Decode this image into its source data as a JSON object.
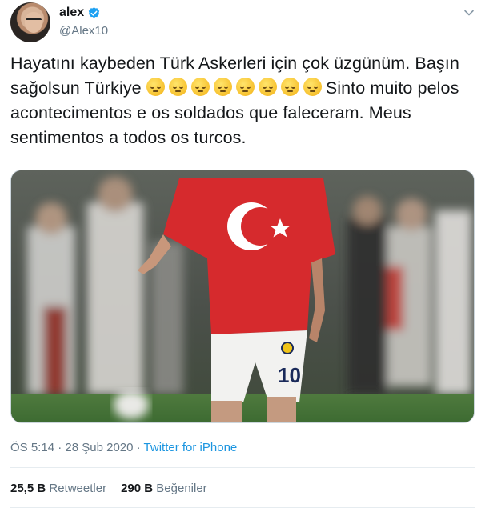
{
  "user": {
    "name": "alex",
    "handle": "@Alex10",
    "verified": true
  },
  "tweet": {
    "text_part1": "Hayatını kaybeden Türk Askerleri için çok üzgünüm. Başın sağolsun Türkiye ",
    "emoji_name": "pensive-face",
    "emoji_count": 8,
    "text_part2": "Sinto muito pelos acontecimentos e os soldados que faleceram. Meus sentimentos a todos os turcos.",
    "time": "ÖS 5:14",
    "separator": "·",
    "date": "28 Şub 2020",
    "source": "Twitter for iPhone"
  },
  "stats": {
    "retweets_count": "25,5 B",
    "retweets_label": "Retweetler",
    "likes_count": "290 B",
    "likes_label": "Beğeniler"
  },
  "colors": {
    "link": "#1b95e0",
    "secondary": "#657786",
    "verified": "#1da1f2",
    "flag_red": "#d62a2d"
  }
}
